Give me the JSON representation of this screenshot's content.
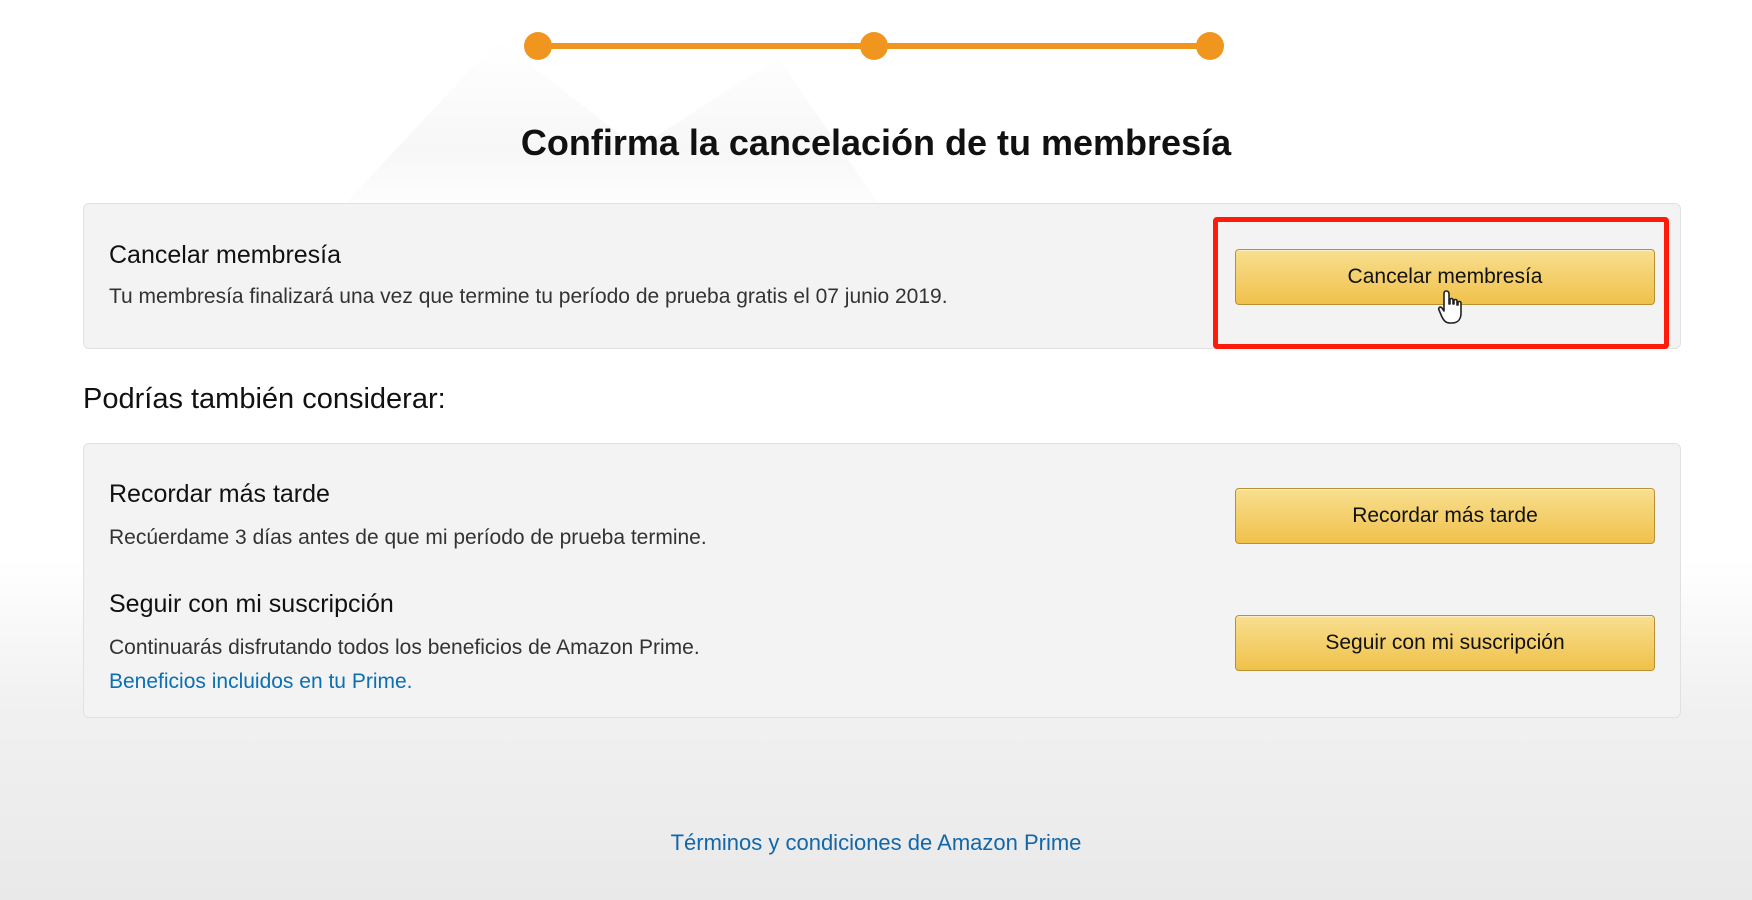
{
  "progress": {
    "steps": 3,
    "current_step": 3,
    "color": "#f0951e"
  },
  "page_title": "Confirma la cancelación de tu membresía",
  "cancel_section": {
    "title": "Cancelar membresía",
    "description": "Tu membresía finalizará una vez que termine tu período de prueba gratis el 07 junio 2019.",
    "button_label": "Cancelar membresía",
    "highlight_color": "#ff1a0a"
  },
  "consider_heading": "Podrías también considerar:",
  "remind_section": {
    "title": "Recordar más tarde",
    "description": "Recúerdame 3 días antes de que mi período de prueba termine.",
    "button_label": "Recordar más tarde"
  },
  "continue_section": {
    "title": "Seguir con mi suscripción",
    "description": "Continuarás disfrutando todos los beneficios de Amazon Prime.",
    "link_label": "Beneficios incluidos en tu Prime.",
    "button_label": "Seguir con mi suscripción"
  },
  "footer": {
    "terms_link": "Términos y condiciones de Amazon Prime"
  },
  "icons": {
    "cursor": "hand-pointer-icon"
  },
  "colors": {
    "button_gradient_top": "#f8df8f",
    "button_gradient_bottom": "#f0c14b",
    "link": "#0a6fb3"
  }
}
